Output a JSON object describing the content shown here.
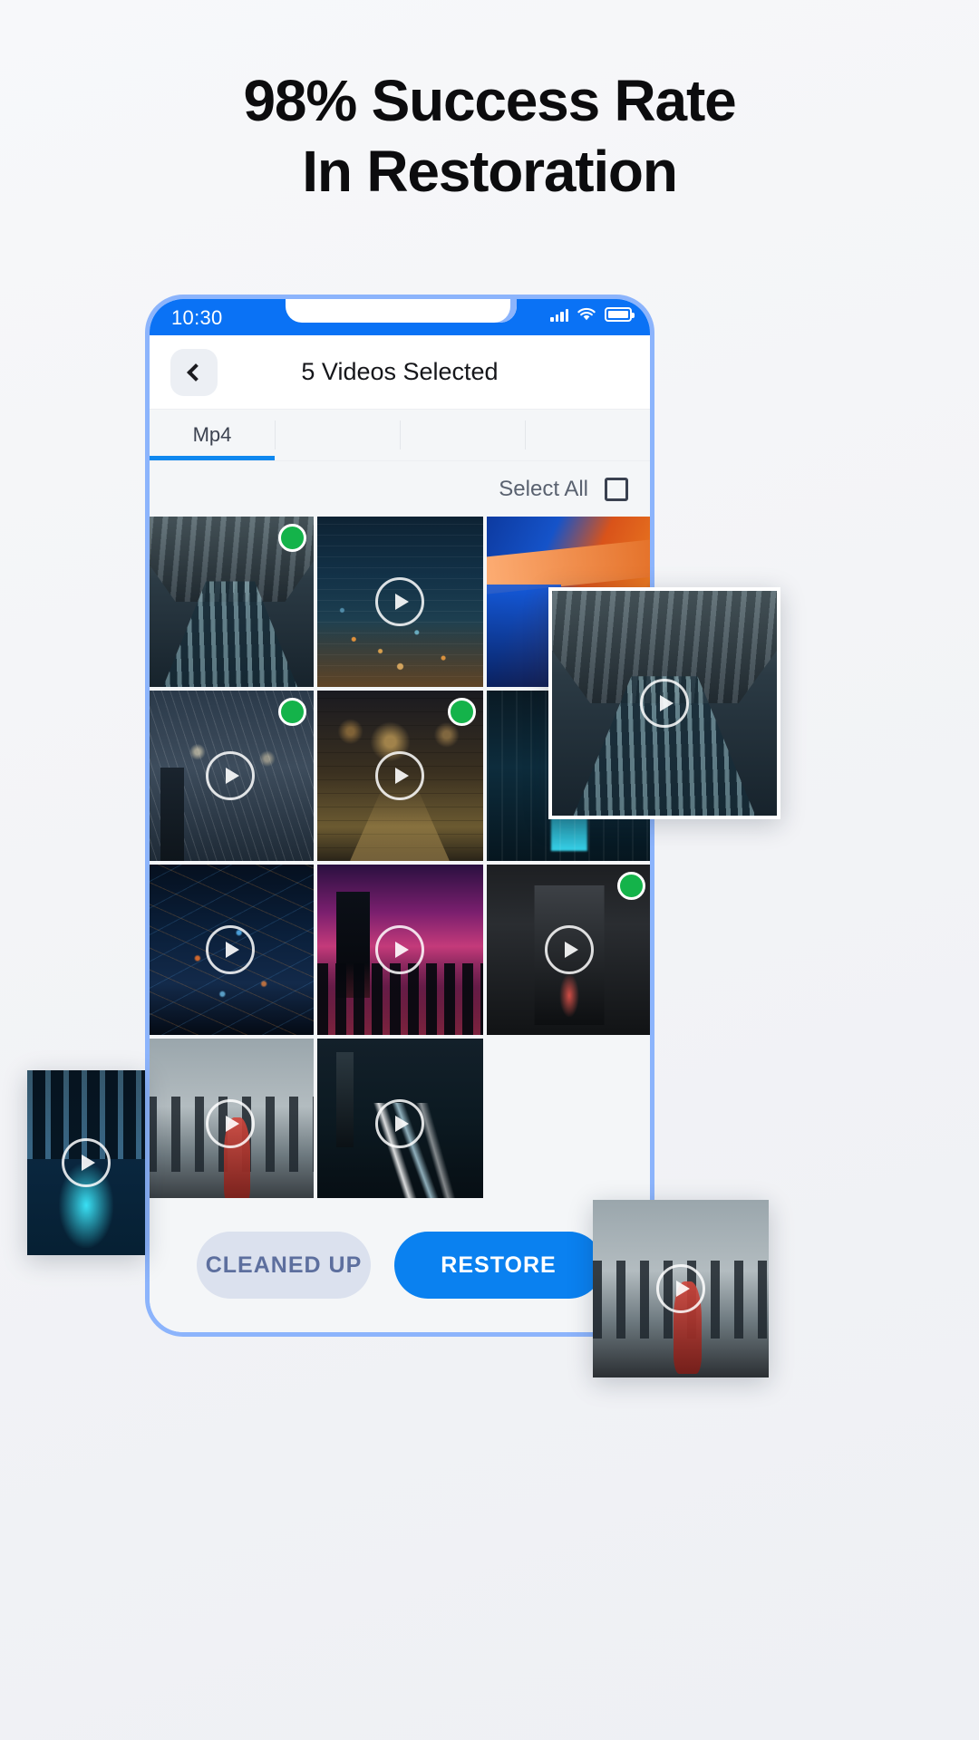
{
  "headline": {
    "line1": "98% Success Rate",
    "line2": "In Restoration"
  },
  "phone": {
    "status_bar": {
      "time": "10:30",
      "signal_icon": "signal-bars-icon",
      "wifi_icon": "wifi-icon",
      "battery_icon": "battery-icon"
    },
    "app_bar": {
      "back_icon": "back-chevron-icon",
      "title": "5 Videos Selected"
    },
    "tabs": [
      {
        "label": "Mp4",
        "active": true
      },
      {
        "label": "",
        "active": false
      },
      {
        "label": "",
        "active": false
      },
      {
        "label": "",
        "active": false
      }
    ],
    "select_all": {
      "label": "Select All",
      "checkbox_icon": "checkbox-unchecked-icon",
      "checked": false
    },
    "gallery": {
      "play_icon": "play-circle-icon",
      "check_icon": "check-circle-icon",
      "selected_color": "#14b34a",
      "items": [
        {
          "name": "glass-corridor-video",
          "art": "art-hall",
          "selected": true,
          "play": false
        },
        {
          "name": "night-city-aerial-video",
          "art": "art-city1",
          "selected": false,
          "play": true
        },
        {
          "name": "orange-interior-video",
          "art": "art-orange",
          "selected": false,
          "play": false
        },
        {
          "name": "snowy-street-video",
          "art": "art-snow",
          "selected": true,
          "play": true
        },
        {
          "name": "city-street-night-video",
          "art": "art-street",
          "selected": true,
          "play": true
        },
        {
          "name": "teal-corridor-video",
          "art": "art-teal",
          "selected": false,
          "play": false
        },
        {
          "name": "blue-aerial-city-video",
          "art": "art-city2",
          "selected": false,
          "play": true
        },
        {
          "name": "pink-skyline-video",
          "art": "art-pink",
          "selected": false,
          "play": true
        },
        {
          "name": "dark-alley-video",
          "art": "art-alley",
          "selected": true,
          "play": true
        },
        {
          "name": "woman-skyline-video",
          "art": "art-woman",
          "selected": false,
          "play": true
        },
        {
          "name": "light-trails-video",
          "art": "art-trails",
          "selected": false,
          "play": true
        }
      ]
    },
    "bottom_bar": {
      "secondary_label": "CLEANED UP",
      "primary_label": "RESTORE",
      "primary_color": "#0a81f0",
      "secondary_color": "#dbe1ee"
    }
  },
  "floating_previews": [
    {
      "name": "floating-glass-corridor-preview",
      "art": "art-hall",
      "play": true
    },
    {
      "name": "floating-neon-city-preview",
      "art": "art-neon",
      "play": true
    },
    {
      "name": "floating-woman-skyline-preview",
      "art": "art-woman",
      "play": true
    }
  ]
}
